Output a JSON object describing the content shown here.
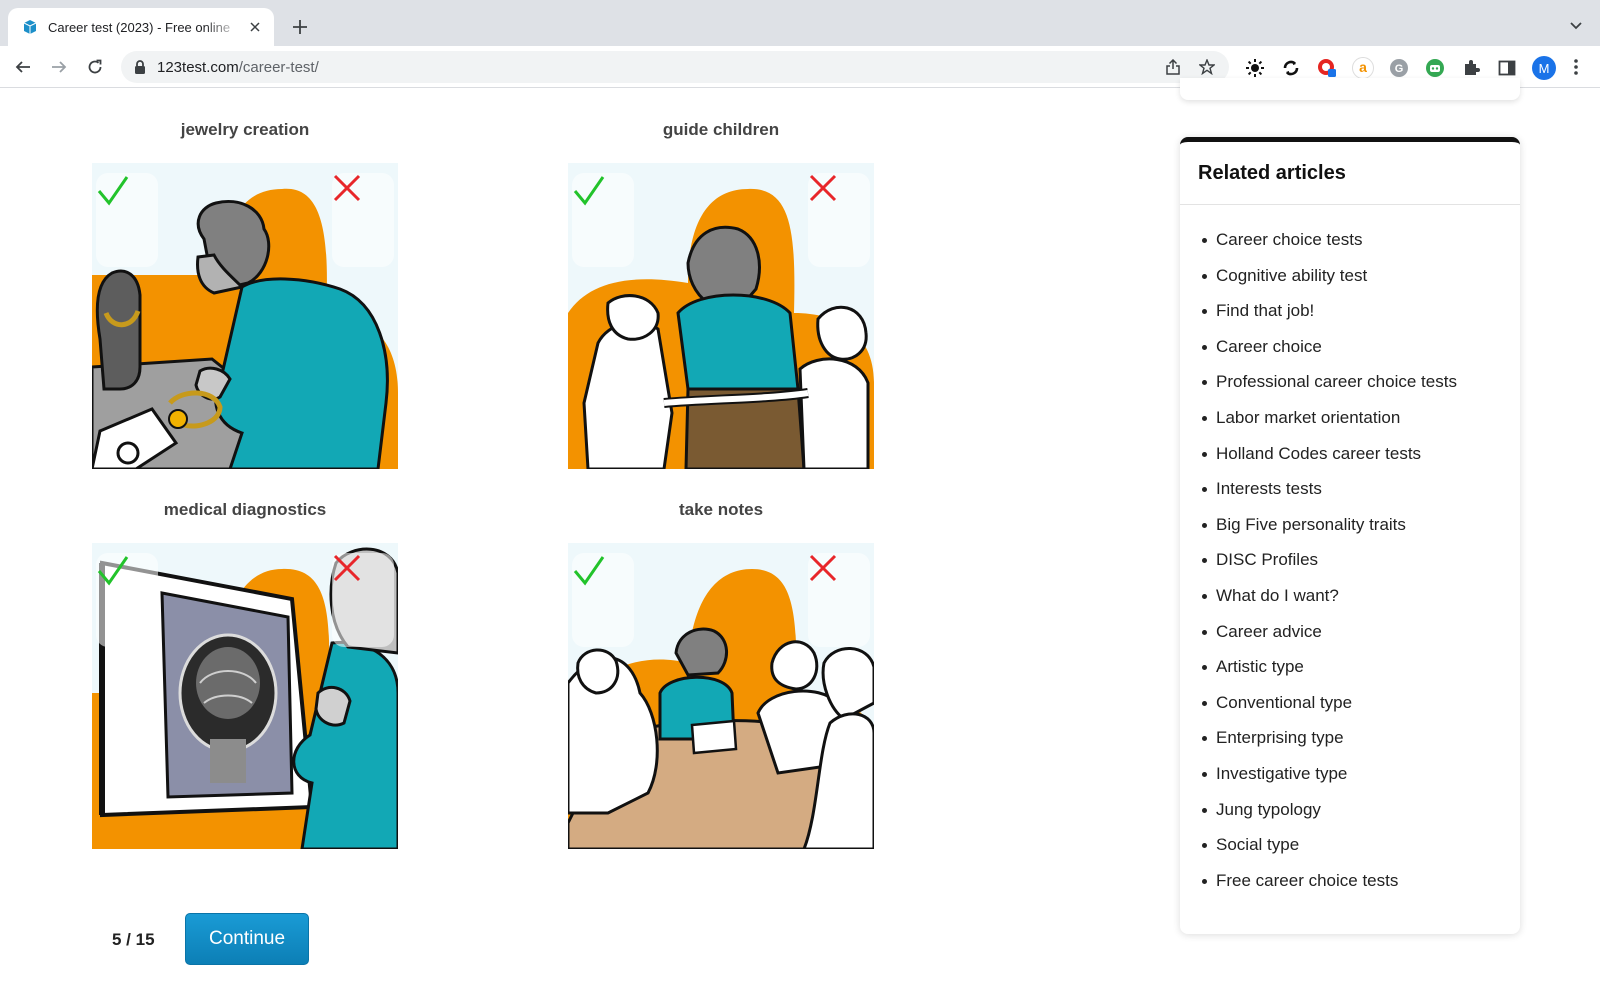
{
  "browser": {
    "tab_title": "Career test (2023) - Free online",
    "url_host": "123test.com",
    "url_path": "/career-test/",
    "avatar_letter": "M"
  },
  "cards": [
    {
      "label": "jewelry creation"
    },
    {
      "label": "guide children"
    },
    {
      "label": "medical diagnostics"
    },
    {
      "label": "take notes"
    }
  ],
  "progress": "5 / 15",
  "continue_label": "Continue",
  "related": {
    "title": "Related articles",
    "items": [
      "Career choice tests",
      "Cognitive ability test",
      "Find that job!",
      "Career choice",
      "Professional career choice tests",
      "Labor market orientation",
      "Holland Codes career tests",
      "Interests tests",
      "Big Five personality traits",
      "DISC Profiles",
      "What do I want?",
      "Career advice",
      "Artistic type",
      "Conventional type",
      "Enterprising type",
      "Investigative type",
      "Jung typology",
      "Social type",
      "Free career choice tests"
    ]
  },
  "colors": {
    "accent_orange": "#f39200",
    "teal": "#12a8b5",
    "check_green": "#22c32b",
    "cross_red": "#e8262a",
    "button_blue": "#1591cc"
  }
}
